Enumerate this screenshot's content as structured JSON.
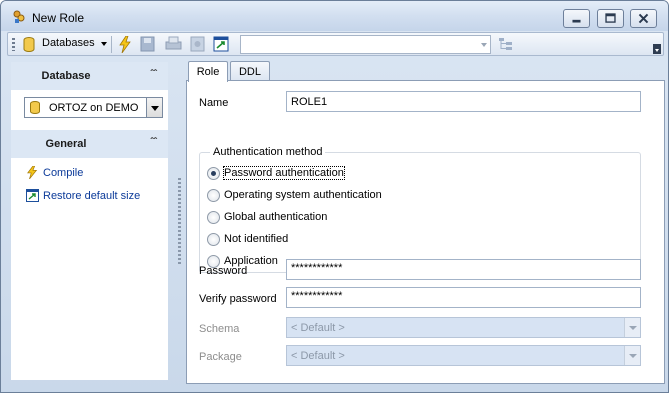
{
  "window": {
    "title": "New Role"
  },
  "toolbar": {
    "databases_label": "Databases",
    "combo_value": ""
  },
  "left_panel": {
    "database_section": {
      "title": "Database",
      "selected_db": "ORTOZ on DEMO"
    },
    "general_section": {
      "title": "General",
      "links": [
        {
          "label": "Compile",
          "icon": "compile-bolt-icon"
        },
        {
          "label": "Restore default size",
          "icon": "restore-size-icon"
        }
      ]
    }
  },
  "tabs": [
    {
      "label": "Role",
      "active": true
    },
    {
      "label": "DDL",
      "active": false
    }
  ],
  "form": {
    "name_label": "Name",
    "name_value": "ROLE1",
    "auth_group_label": "Authentication method",
    "auth_options": [
      {
        "label": "Password authentication",
        "selected": true
      },
      {
        "label": "Operating system authentication",
        "selected": false
      },
      {
        "label": "Global authentication",
        "selected": false
      },
      {
        "label": "Not identified",
        "selected": false
      },
      {
        "label": "Application",
        "selected": false
      }
    ],
    "password_label": "Password",
    "password_value": "************",
    "verify_label": "Verify password",
    "verify_value": "************",
    "schema_label": "Schema",
    "schema_value": "< Default >",
    "package_label": "Package",
    "package_value": "< Default >"
  },
  "colors": {
    "link": "#0b3a99",
    "disabled_field": "#d7e3f3",
    "section_header": "#dce7f4"
  }
}
